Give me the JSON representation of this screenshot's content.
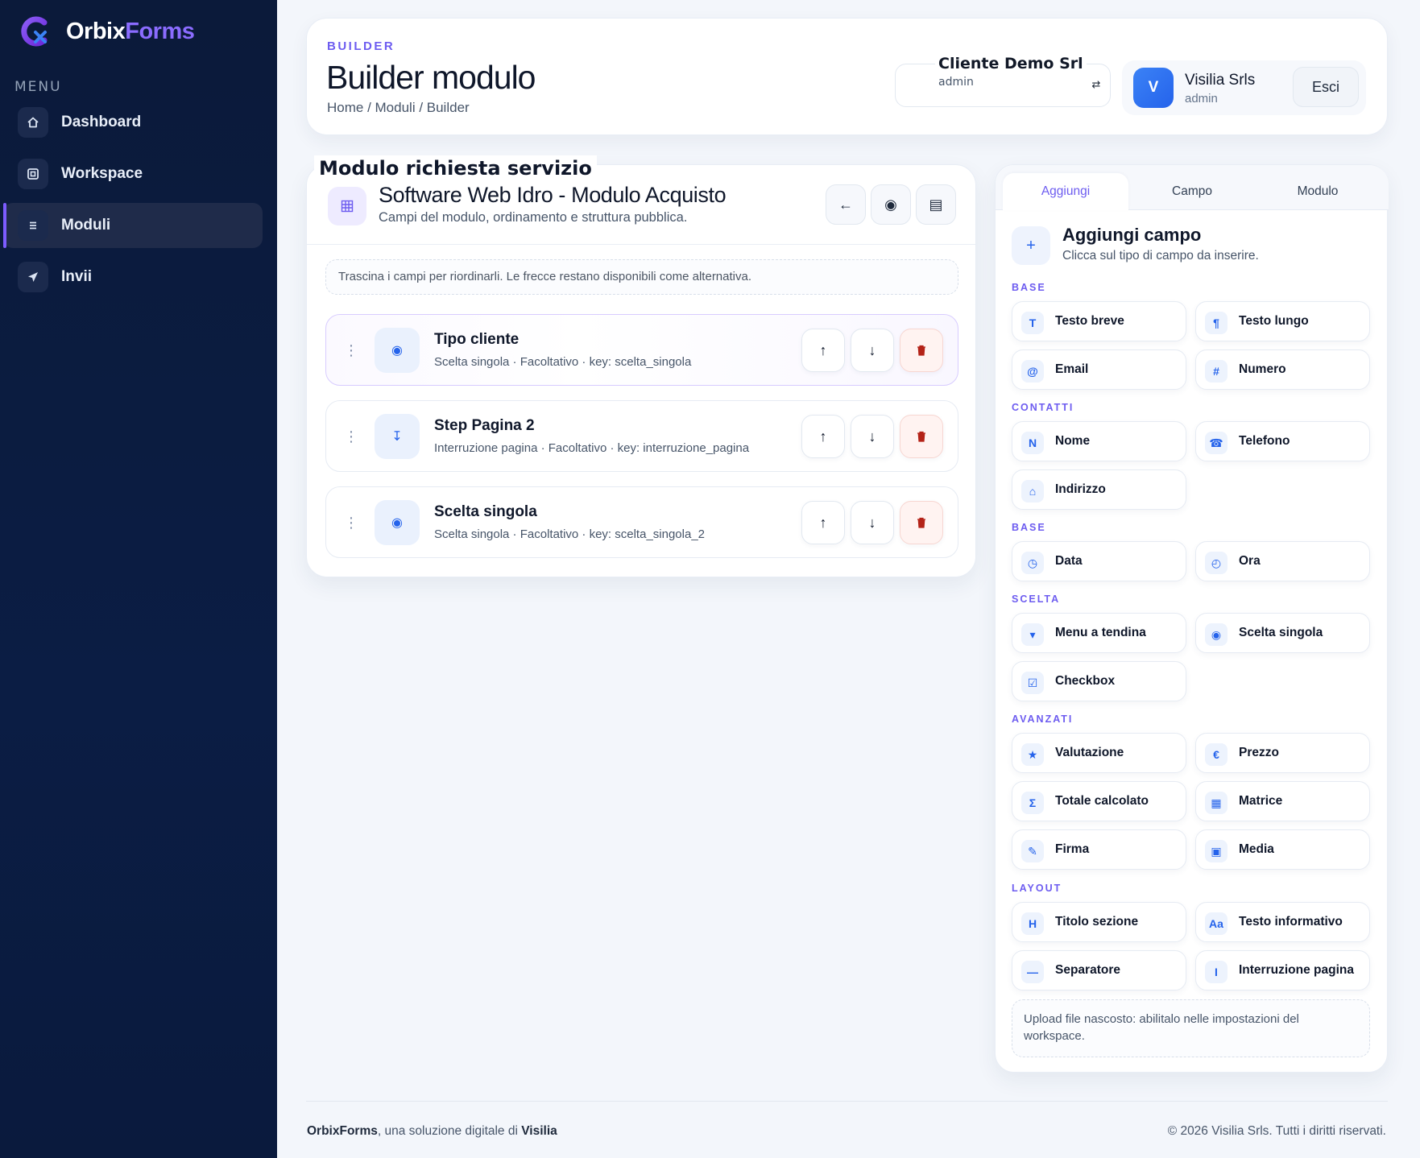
{
  "brand": {
    "name_primary": "Orbix",
    "name_accent": "Forms",
    "accent_color": "#8b6cff"
  },
  "sidebar": {
    "menu_label": "MENU",
    "items": [
      {
        "label": "Dashboard",
        "icon": "home-icon",
        "active": false
      },
      {
        "label": "Workspace",
        "icon": "workspace-icon",
        "active": false
      },
      {
        "label": "Moduli",
        "icon": "list-icon",
        "active": true
      },
      {
        "label": "Invii",
        "icon": "send-icon",
        "active": false
      }
    ]
  },
  "header": {
    "eyebrow": "BUILDER",
    "title": "Builder modulo",
    "breadcrumb": "Home / Moduli / Builder",
    "client": {
      "name": "Cliente Demo Srl",
      "role": "admin",
      "switch_icon": "switch-icon"
    },
    "user": {
      "avatar_letter": "V",
      "name": "Visilia Srls",
      "role": "admin"
    },
    "logout_label": "Esci"
  },
  "form": {
    "overlay_title": "Modulo richiesta servizio",
    "title": "Software Web Idro - Modulo Acquisto",
    "subtitle": "Campi del modulo, ordinamento e struttura pubblica.",
    "buttons": {
      "back": "←",
      "preview": "◉",
      "settings": "▤"
    },
    "hint": "Trascina i campi per riordinarli. Le frecce restano disponibili come alternativa.",
    "fields": [
      {
        "name": "Tipo cliente",
        "meta": "Scelta singola · Facoltativo · key: scelta_singola",
        "icon": "◉",
        "selected": true
      },
      {
        "name": "Step Pagina 2",
        "meta": "Interruzione pagina · Facoltativo · key: interruzione_pagina",
        "icon": "↧",
        "selected": false
      },
      {
        "name": "Scelta singola",
        "meta": "Scelta singola · Facoltativo · key: scelta_singola_2",
        "icon": "◉",
        "selected": false
      }
    ]
  },
  "panel": {
    "tabs": [
      {
        "label": "Aggiungi",
        "active": true
      },
      {
        "label": "Campo",
        "active": false
      },
      {
        "label": "Modulo",
        "active": false
      }
    ],
    "add_title": "Aggiungi campo",
    "add_subtitle": "Clicca sul tipo di campo da inserire.",
    "sections": [
      {
        "label": "BASE",
        "items": [
          {
            "label": "Testo breve",
            "icon": "T"
          },
          {
            "label": "Testo lungo",
            "icon": "¶"
          },
          {
            "label": "Email",
            "icon": "@"
          },
          {
            "label": "Numero",
            "icon": "#"
          }
        ]
      },
      {
        "label": "CONTATTI",
        "items": [
          {
            "label": "Nome",
            "icon": "N"
          },
          {
            "label": "Telefono",
            "icon": "☎"
          },
          {
            "label": "Indirizzo",
            "icon": "⌂"
          }
        ]
      },
      {
        "label": "BASE",
        "items": [
          {
            "label": "Data",
            "icon": "◷"
          },
          {
            "label": "Ora",
            "icon": "◴"
          }
        ]
      },
      {
        "label": "SCELTA",
        "items": [
          {
            "label": "Menu a tendina",
            "icon": "▾"
          },
          {
            "label": "Scelta singola",
            "icon": "◉"
          },
          {
            "label": "Checkbox",
            "icon": "☑"
          }
        ]
      },
      {
        "label": "AVANZATI",
        "items": [
          {
            "label": "Valutazione",
            "icon": "★"
          },
          {
            "label": "Prezzo",
            "icon": "€"
          },
          {
            "label": "Totale calcolato",
            "icon": "Σ"
          },
          {
            "label": "Matrice",
            "icon": "▦"
          },
          {
            "label": "Firma",
            "icon": "✎"
          },
          {
            "label": "Media",
            "icon": "▣"
          }
        ]
      },
      {
        "label": "LAYOUT",
        "items": [
          {
            "label": "Titolo sezione",
            "icon": "H"
          },
          {
            "label": "Testo informativo",
            "icon": "Aa"
          },
          {
            "label": "Separatore",
            "icon": "—"
          },
          {
            "label": "Interruzione pagina",
            "icon": "I"
          }
        ]
      }
    ],
    "upload_note": "Upload file nascosto: abilitalo nelle impostazioni del workspace."
  },
  "footer": {
    "left_brand": "OrbixForms",
    "left_middle": ", una soluzione digitale di ",
    "left_company": "Visilia",
    "right": "© 2026 Visilia Srls. Tutti i diritti riservati."
  }
}
